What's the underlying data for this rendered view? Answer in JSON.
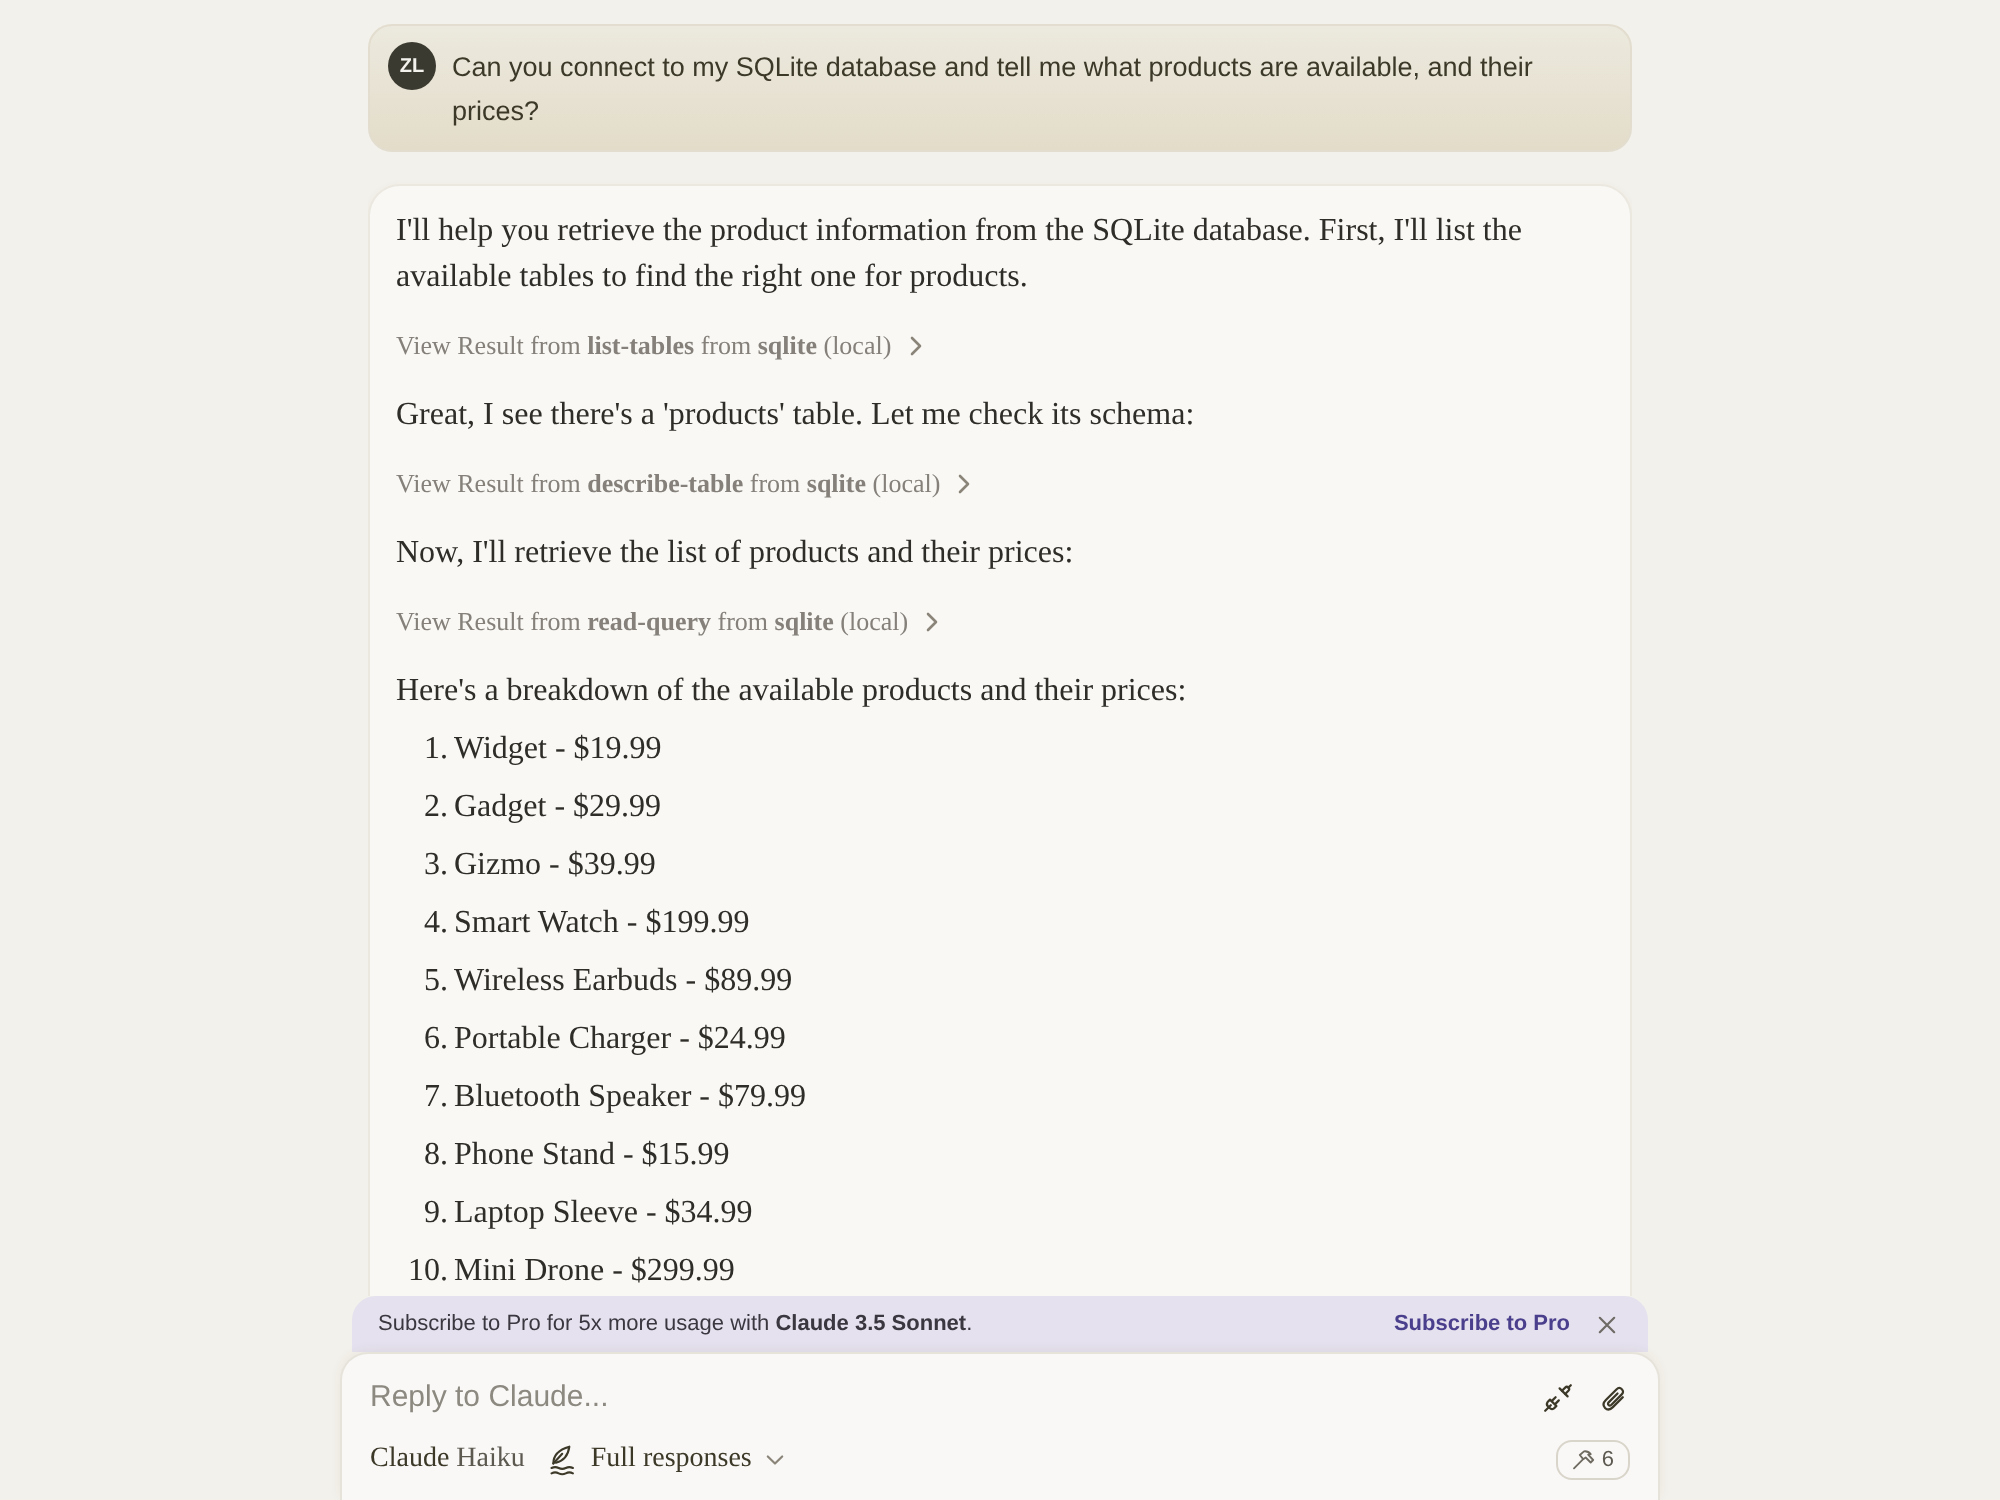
{
  "user_message": {
    "initials": "ZL",
    "text": "Can you connect to my SQLite database and tell me what products are available, and their prices?"
  },
  "assistant_message": {
    "blocks": [
      {
        "kind": "paragraph",
        "text": "I'll help you retrieve the product information from the SQLite database. First, I'll list the available tables to find the right one for products."
      },
      {
        "kind": "tool_result",
        "text": "View Result from **list-tables** from **sqlite** (local)"
      },
      {
        "kind": "paragraph",
        "text": "Great, I see there's a 'products' table. Let me check its schema:"
      },
      {
        "kind": "tool_result",
        "text": "View Result from **describe-table** from **sqlite** (local)"
      },
      {
        "kind": "paragraph",
        "text": "Now, I'll retrieve the list of products and their prices:"
      },
      {
        "kind": "tool_result",
        "text": "View Result from **read-query** from **sqlite** (local)"
      },
      {
        "kind": "paragraph",
        "text": "Here's a breakdown of the available products and their prices:"
      },
      {
        "kind": "list",
        "items": [
          {
            "number": "1.",
            "text": "Widget - $19.99"
          },
          {
            "number": "2.",
            "text": "Gadget - $29.99"
          },
          {
            "number": "3.",
            "text": "Gizmo - $39.99"
          },
          {
            "number": "4.",
            "text": "Smart Watch - $199.99"
          },
          {
            "number": "5.",
            "text": "Wireless Earbuds - $89.99"
          },
          {
            "number": "6.",
            "text": "Portable Charger - $24.99"
          },
          {
            "number": "7.",
            "text": "Bluetooth Speaker - $79.99"
          },
          {
            "number": "8.",
            "text": "Phone Stand - $15.99"
          },
          {
            "number": "9.",
            "text": "Laptop Sleeve - $34.99"
          },
          {
            "number": "10.",
            "text": "Mini Drone - $299.99"
          }
        ]
      }
    ]
  },
  "banner": {
    "text": "Subscribe to Pro for 5x more usage with **Claude 3.5 Sonnet**.",
    "action": "Subscribe to Pro"
  },
  "composer": {
    "placeholder": "Reply to Claude...",
    "model": {
      "brand": "Claude",
      "name": "Haiku"
    },
    "style": "Full responses",
    "tools_count": "6"
  }
}
